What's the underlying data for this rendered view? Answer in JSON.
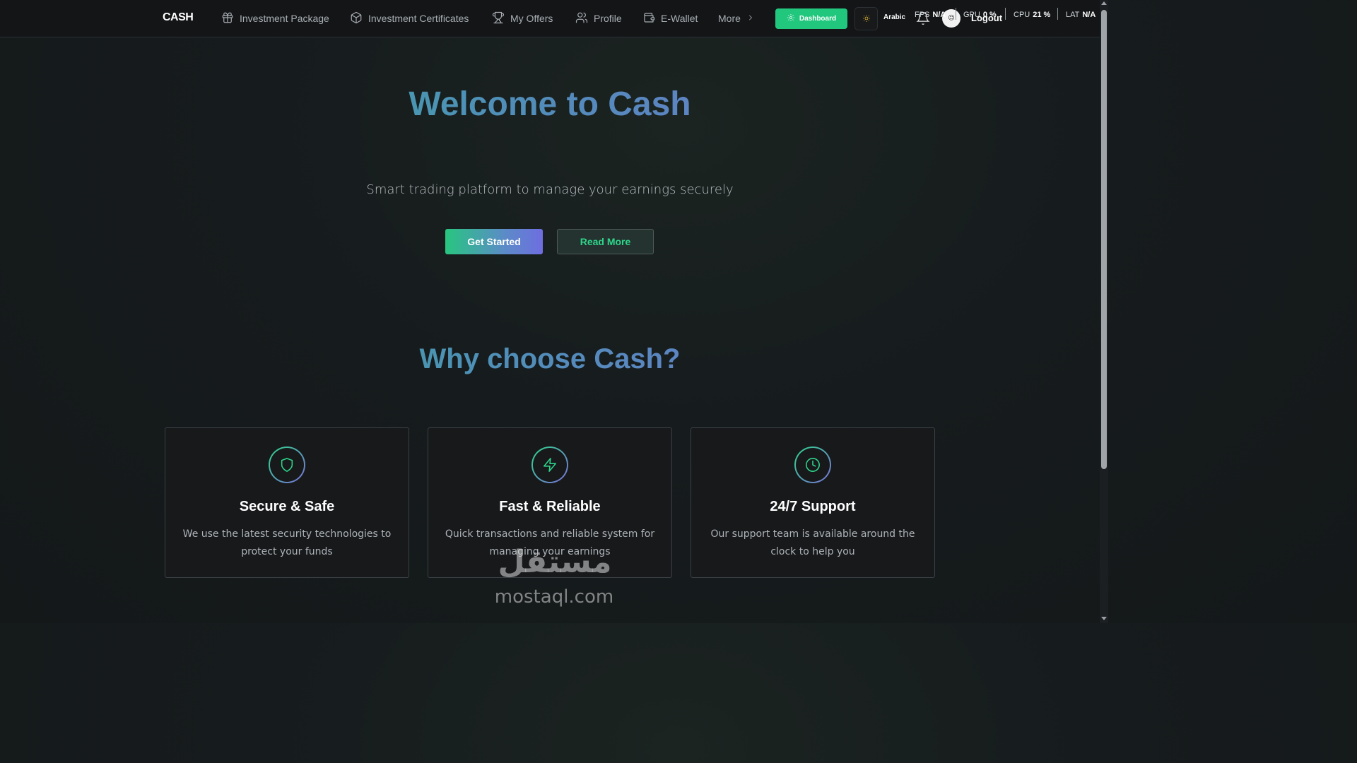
{
  "nav": {
    "logo": "CASH",
    "items": [
      {
        "label": "Investment Package"
      },
      {
        "label": "Investment Certificates"
      },
      {
        "label": "My Offers"
      },
      {
        "label": "Profile"
      },
      {
        "label": "E-Wallet"
      },
      {
        "label": "More"
      }
    ],
    "dashboard_label": "Dashboard",
    "language_label": "Arabic",
    "logout_label": "Logout"
  },
  "perf": {
    "fps_label": "FPS",
    "fps_value": "N/A",
    "gpu_label": "GPU",
    "gpu_value": "0 %",
    "cpu_label": "CPU",
    "cpu_value": "21 %",
    "lat_label": "LAT",
    "lat_value": "N/A"
  },
  "hero": {
    "title": "Welcome to Cash",
    "subtitle": "Smart trading platform to manage your earnings securely",
    "primary_button": "Get Started",
    "secondary_button": "Read More"
  },
  "why": {
    "title": "Why choose Cash?",
    "cards": [
      {
        "icon": "shield-icon",
        "title": "Secure & Safe",
        "description": "We use the latest security technologies to protect your funds"
      },
      {
        "icon": "lightning-icon",
        "title": "Fast & Reliable",
        "description": "Quick transactions and reliable system for managing your earnings"
      },
      {
        "icon": "clock-icon",
        "title": "24/7 Support",
        "description": "Our support team is available around the clock to help you"
      }
    ]
  },
  "watermark": {
    "arabic": "مستقل",
    "latin": "mostaql.com"
  },
  "colors": {
    "accent_green": "#22c77e",
    "gradient_start": "#2fb590",
    "gradient_end": "#7a6fd8",
    "background": "#151a1c"
  }
}
